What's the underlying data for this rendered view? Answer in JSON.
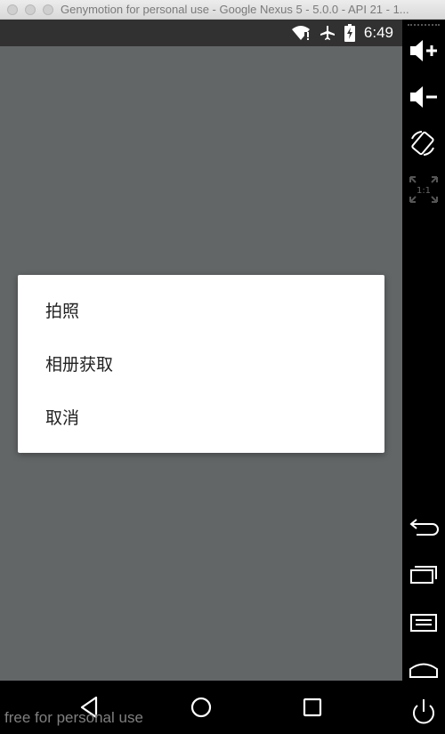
{
  "window": {
    "title": "Genymotion for personal use - Google Nexus 5 - 5.0.0 - API 21 - 1..."
  },
  "statusbar": {
    "time": "6:49",
    "icons": [
      "wifi-icon",
      "airplane-icon",
      "battery-charging-icon"
    ]
  },
  "dialog": {
    "items": [
      {
        "label": "拍照"
      },
      {
        "label": "相册获取"
      },
      {
        "label": "取消"
      }
    ]
  },
  "navbar": {
    "buttons": [
      "back-icon",
      "home-icon",
      "recents-icon"
    ]
  },
  "watermark": "free for personal use",
  "sidebar": {
    "buttons": [
      "volume-up-icon",
      "volume-down-icon",
      "rotate-icon",
      "scale-icon",
      "back-icon",
      "recents-icon",
      "menu-icon",
      "home-icon",
      "power-icon"
    ],
    "scale_label": "1:1"
  },
  "colors": {
    "screen_background": "#636667",
    "status_bar": "#313131",
    "dialog_background": "#ffffff"
  }
}
